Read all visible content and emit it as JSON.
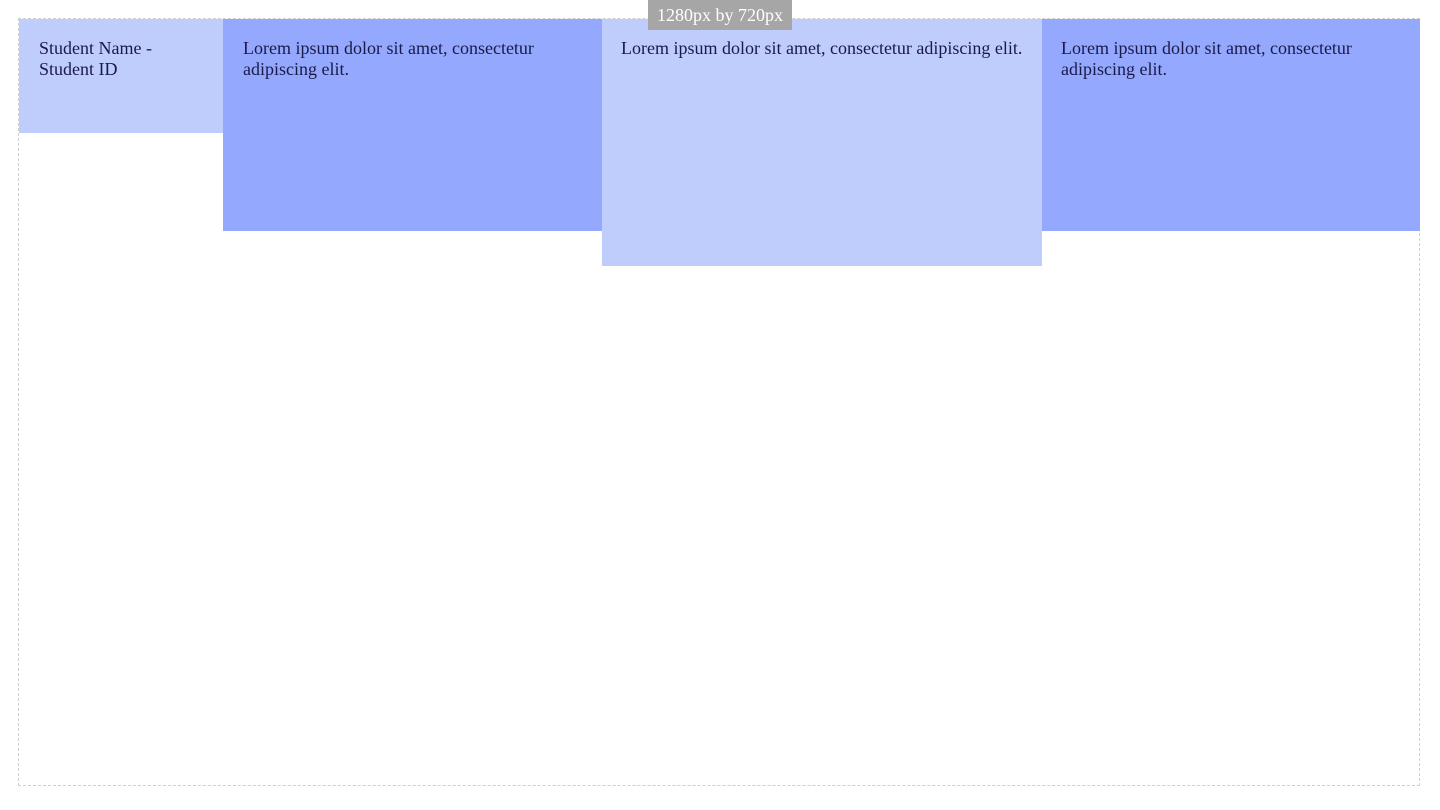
{
  "badge": {
    "text": "1280px by 720px"
  },
  "colors": {
    "light_block": "#bfcdfd",
    "dark_block": "#94a9fd",
    "badge_bg": "#a6a6a6",
    "frame_border": "#cfcfcf"
  },
  "cells": {
    "student": {
      "text": "Student Name - Student ID"
    },
    "block_1": {
      "text": "Lorem ipsum dolor sit amet, consectetur adipiscing elit."
    },
    "block_2": {
      "text": "Lorem ipsum dolor sit amet, consectetur adipiscing elit."
    },
    "block_3": {
      "text": "Lorem ipsum dolor sit amet, consectetur adipiscing elit."
    }
  }
}
